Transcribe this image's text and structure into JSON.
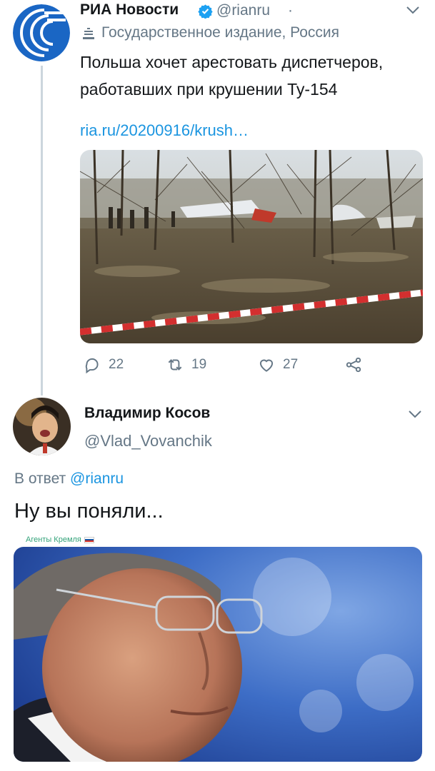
{
  "tweet": {
    "author_name": "РИА Новости",
    "handle": "@rianru",
    "separator": "·",
    "state_media_label": "Государственное издание, Россия",
    "text": "Польша хочет арестовать диспетчеров, работавших при крушении Ту-154",
    "link": "ria.ru/20200916/krush…",
    "photo_description_icon": "crash-site-photo",
    "stats": {
      "replies": "22",
      "retweets": "19",
      "likes": "27"
    }
  },
  "reply": {
    "author_name": "Владимир Косов",
    "handle": "@Vlad_Vovanchik",
    "reply_prefix": "В ответ",
    "reply_mention": "@rianru",
    "text": "Ну вы поняли...",
    "watermark": "Агенты Кремля"
  },
  "colors": {
    "link": "#1b95e0",
    "secondary_text": "#657786",
    "primary_text": "#14171a",
    "verified": "#1da1f2",
    "thread_line": "#ccd6dd",
    "ria_logo": "#1a66c4"
  }
}
